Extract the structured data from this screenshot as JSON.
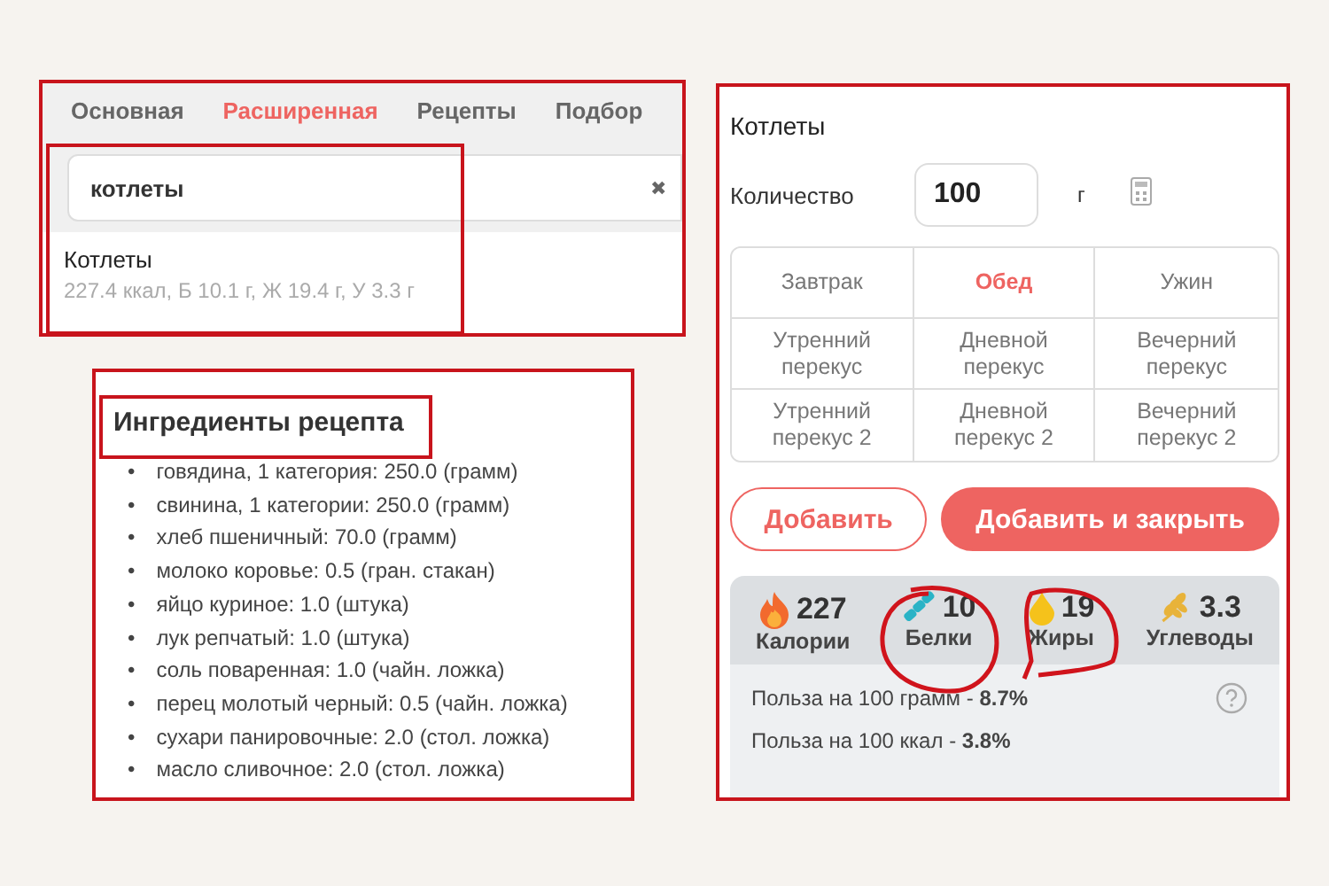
{
  "search_panel": {
    "tabs": [
      {
        "label": "Основная",
        "selected": false
      },
      {
        "label": "Расширенная",
        "selected": true
      },
      {
        "label": "Рецепты",
        "selected": false
      },
      {
        "label": "Подбор",
        "selected": false
      }
    ],
    "search": {
      "value": "котлеты",
      "clear": "✖"
    },
    "result": {
      "name": "Котлеты",
      "details": "227.4 ккал, Б 10.1 г, Ж 19.4 г, У 3.3 г"
    }
  },
  "ingredients_panel": {
    "heading": "Ингредиенты рецепта",
    "bullet": "•",
    "items": [
      "говядина, 1 категория: 250.0 (грамм)",
      "свинина, 1 категории: 250.0 (грамм)",
      "хлеб пшеничный: 70.0 (грамм)",
      "молоко коровье: 0.5 (гран. стакан)",
      "яйцо куриное: 1.0 (штука)",
      "лук репчатый: 1.0 (штука)",
      "соль поваренная: 1.0 (чайн. ложка)",
      "перец молотый черный: 0.5 (чайн. ложка)",
      "сухари панировочные: 2.0 (стол. ложка)",
      "масло сливочное: 2.0 (стол. ложка)"
    ]
  },
  "food_panel": {
    "title": "Котлеты",
    "quantity": {
      "label": "Количество",
      "value": "100",
      "unit": "г"
    },
    "meals": [
      {
        "label": "Завтрак",
        "selected": false
      },
      {
        "label": "Обед",
        "selected": true
      },
      {
        "label": "Ужин",
        "selected": false
      },
      {
        "label": "Утренний перекус",
        "selected": false
      },
      {
        "label": "Дневной перекус",
        "selected": false
      },
      {
        "label": "Вечерний перекус",
        "selected": false
      },
      {
        "label": "Утренний перекус 2",
        "selected": false
      },
      {
        "label": "Дневной перекус 2",
        "selected": false
      },
      {
        "label": "Вечерний перекус 2",
        "selected": false
      }
    ],
    "buttons": [
      {
        "label": "Добавить",
        "kind": "outline"
      },
      {
        "label": "Добавить и закрыть",
        "kind": "filled"
      }
    ],
    "nutrients": [
      {
        "kind": "calories",
        "value": "227",
        "label": "Калории"
      },
      {
        "kind": "protein",
        "value": "10",
        "label": "Белки"
      },
      {
        "kind": "fat",
        "value": "19",
        "label": "Жиры"
      },
      {
        "kind": "carbs",
        "value": "3.3",
        "label": "Углеводы"
      }
    ],
    "benefits": [
      "Польза на 100 грамм - **8.7%**",
      "Польза на 100 ккал - **3.8%**"
    ]
  }
}
